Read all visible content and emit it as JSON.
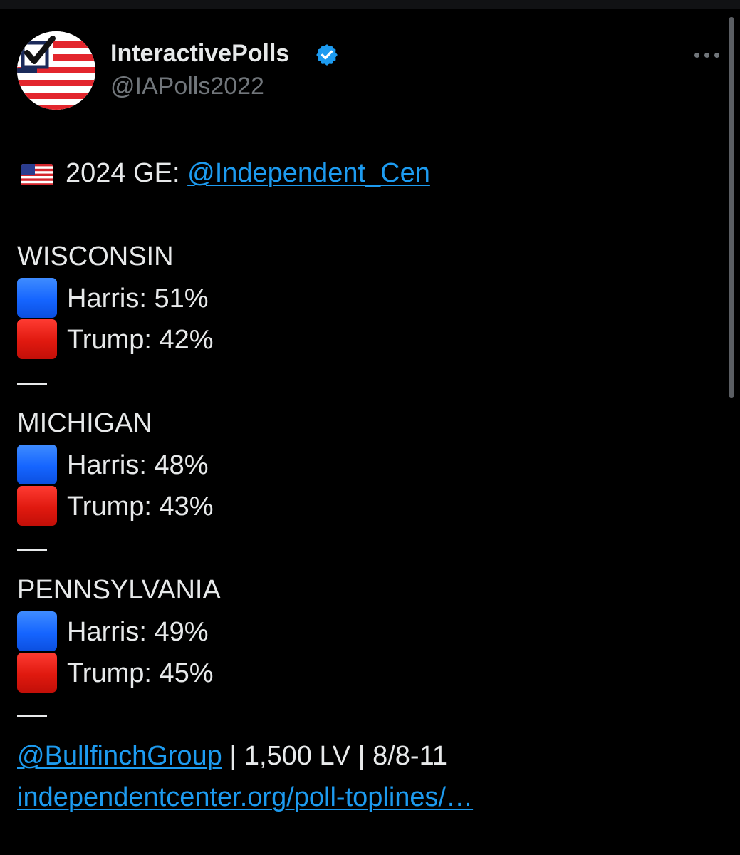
{
  "author": {
    "display_name": "InteractivePolls",
    "handle": "@IAPolls2022",
    "verified": true,
    "avatar_icon": "checkbox-flag-avatar"
  },
  "post": {
    "headline_prefix": "2024 GE: ",
    "headline_mention": "@Independent_Cen",
    "headline_flag_icon": "us-flag-icon",
    "states": [
      {
        "name": "WISCONSIN",
        "rows": [
          {
            "label": "Harris: 51%",
            "color": "#1565ff",
            "icon": "blue-square-icon"
          },
          {
            "label": "Trump: 42%",
            "color": "#e0190f",
            "icon": "red-square-icon"
          }
        ]
      },
      {
        "name": "MICHIGAN",
        "rows": [
          {
            "label": "Harris: 48%",
            "color": "#1565ff",
            "icon": "blue-square-icon"
          },
          {
            "label": "Trump: 43%",
            "color": "#e0190f",
            "icon": "red-square-icon"
          }
        ]
      },
      {
        "name": "PENNSYLVANIA",
        "rows": [
          {
            "label": "Harris: 49%",
            "color": "#1565ff",
            "icon": "blue-square-icon"
          },
          {
            "label": "Trump: 45%",
            "color": "#e0190f",
            "icon": "red-square-icon"
          }
        ]
      }
    ],
    "separator": "—",
    "source_mention": "@BullfinchGroup",
    "source_details": " | 1,500 LV | 8/8-11",
    "source_link": "independentcenter.org/poll-toplines/…"
  },
  "theme": {
    "background": "#000000",
    "text": "#e7e9ea",
    "muted": "#71767b",
    "link": "#1d9bf0"
  }
}
